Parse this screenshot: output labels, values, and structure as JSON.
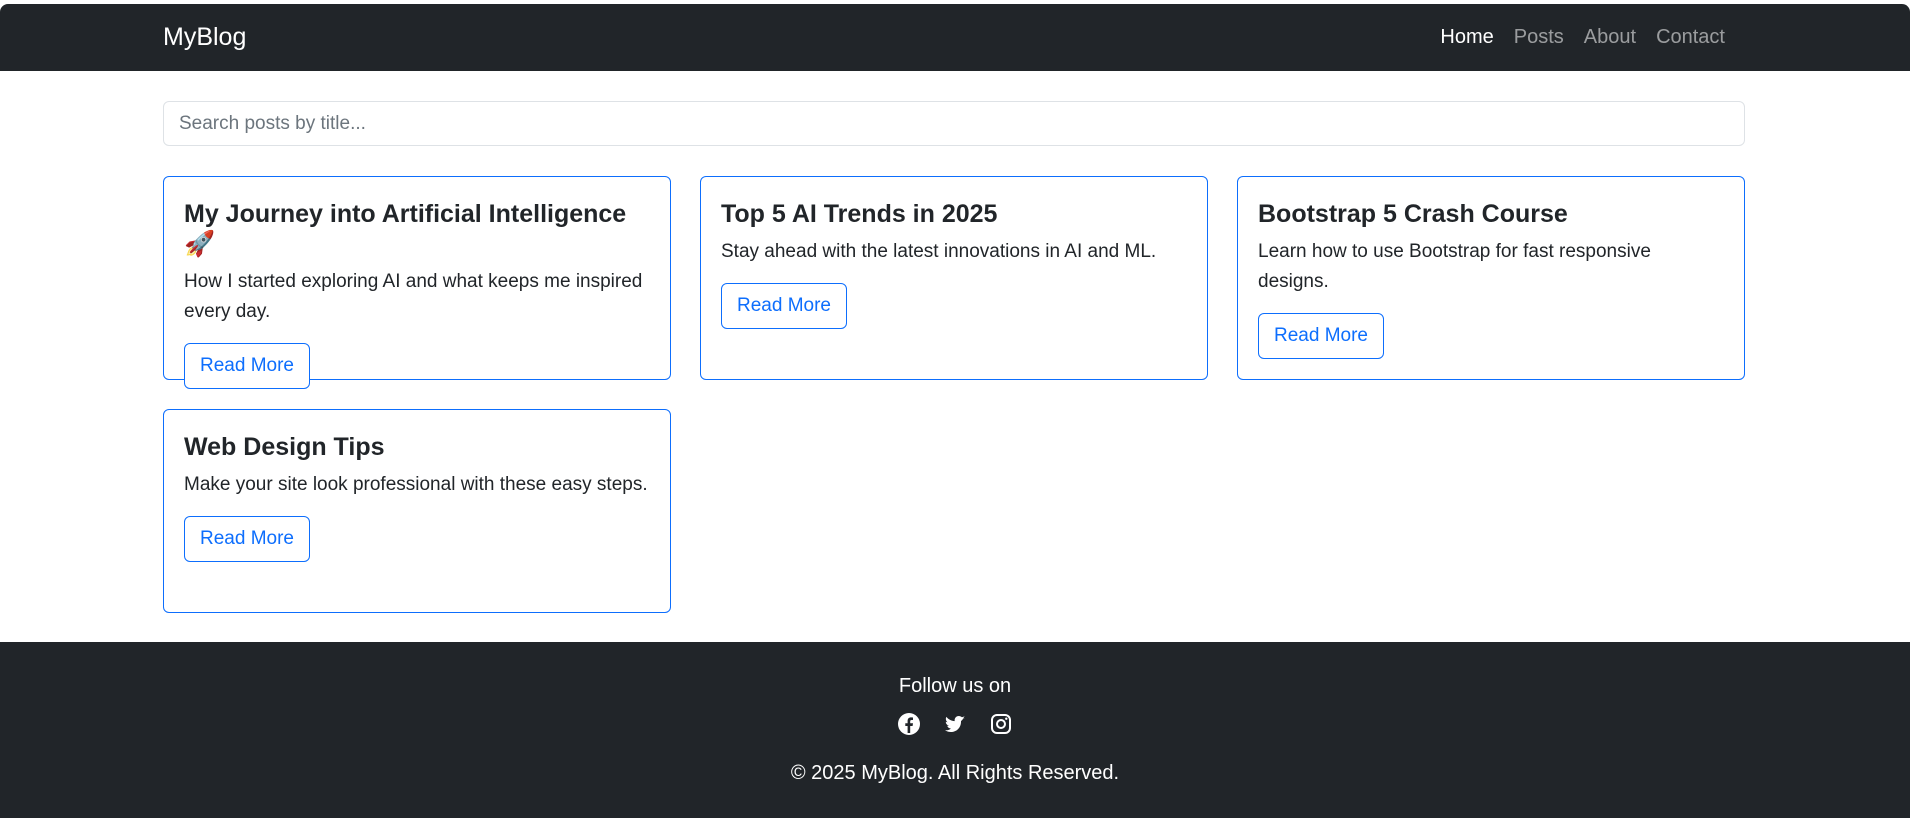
{
  "navbar": {
    "brand": "MyBlog",
    "links": [
      {
        "label": "Home",
        "active": true
      },
      {
        "label": "Posts",
        "active": false
      },
      {
        "label": "About",
        "active": false
      },
      {
        "label": "Contact",
        "active": false
      }
    ]
  },
  "search": {
    "placeholder": "Search posts by title...",
    "value": ""
  },
  "posts": [
    {
      "title": "My Journey into Artificial Intelligence 🚀",
      "excerpt": "How I started exploring AI and what keeps me inspired every day.",
      "button": "Read More"
    },
    {
      "title": "Top 5 AI Trends in 2025",
      "excerpt": "Stay ahead with the latest innovations in AI and ML.",
      "button": "Read More"
    },
    {
      "title": "Bootstrap 5 Crash Course",
      "excerpt": "Learn how to use Bootstrap for fast responsive designs.",
      "button": "Read More"
    },
    {
      "title": "Web Design Tips",
      "excerpt": "Make your site look professional with these easy steps.",
      "button": "Read More"
    }
  ],
  "footer": {
    "follow_text": "Follow us on",
    "socials": [
      "facebook-icon",
      "twitter-icon",
      "instagram-icon"
    ],
    "copyright": "© 2025 MyBlog. All Rights Reserved."
  },
  "colors": {
    "dark": "#212529",
    "primary": "#0d6efd",
    "nav_muted": "rgba(255,255,255,0.55)"
  }
}
